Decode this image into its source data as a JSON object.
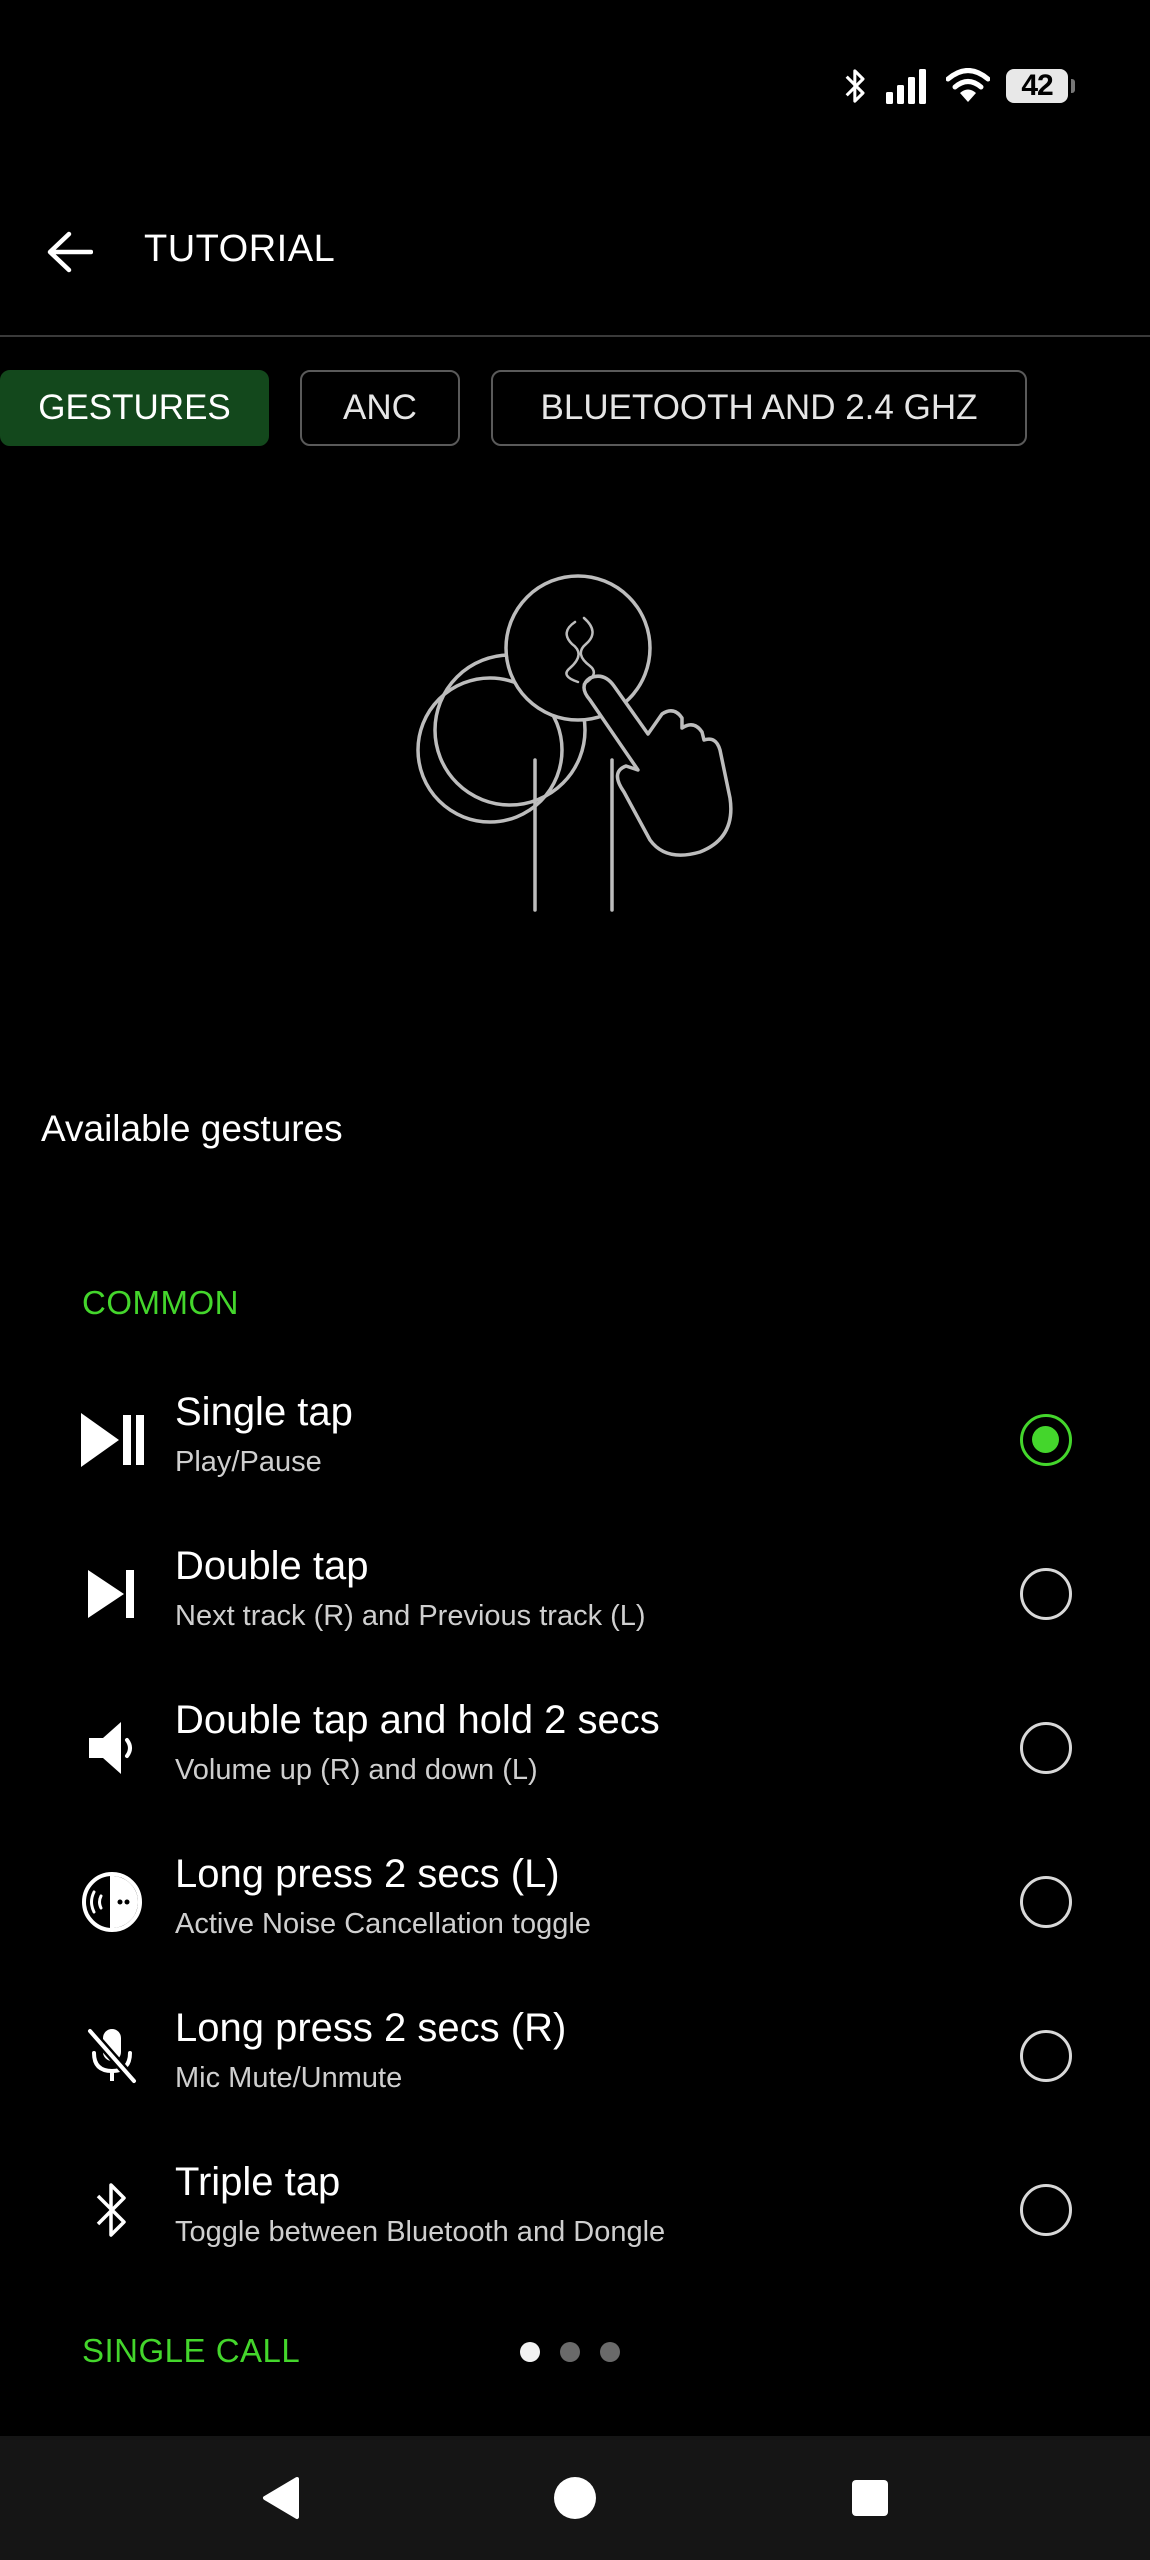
{
  "status_bar": {
    "battery_level": "42",
    "icons": [
      "bluetooth-icon",
      "signal-icon",
      "wifi-icon",
      "battery-icon"
    ]
  },
  "app_bar": {
    "title": "TUTORIAL",
    "back_icon": "arrow-back-icon"
  },
  "tabs": [
    {
      "label": "GESTURES",
      "active": true
    },
    {
      "label": "ANC",
      "active": false
    },
    {
      "label": "BLUETOOTH AND 2.4 GHZ",
      "active": false
    }
  ],
  "illustration": "earbud-touch-gesture-illustration",
  "section_title": "Available gestures",
  "groups": {
    "common": "COMMON",
    "single_call": "SINGLE CALL"
  },
  "gestures": [
    {
      "title": "Single tap",
      "subtitle": "Play/Pause",
      "icon": "play-pause-icon",
      "selected": true
    },
    {
      "title": "Double tap",
      "subtitle": "Next track (R) and Previous track (L)",
      "icon": "skip-next-icon",
      "selected": false
    },
    {
      "title": "Double tap and hold 2 secs",
      "subtitle": "Volume up (R) and down (L)",
      "icon": "volume-icon",
      "selected": false
    },
    {
      "title": "Long press 2 secs (L)",
      "subtitle": "Active Noise Cancellation toggle",
      "icon": "anc-icon",
      "selected": false
    },
    {
      "title": "Long press 2 secs (R)",
      "subtitle": "Mic Mute/Unmute",
      "icon": "mic-off-icon",
      "selected": false
    },
    {
      "title": "Triple tap",
      "subtitle": "Toggle between Bluetooth and Dongle",
      "icon": "bluetooth-icon",
      "selected": false
    }
  ],
  "pager": {
    "count": 3,
    "active_index": 0
  },
  "colors": {
    "accent": "#44d62c",
    "active_tab": "#13481c",
    "background": "#000000"
  },
  "nav_bar": [
    "back-triangle-icon",
    "home-circle-icon",
    "recents-square-icon"
  ]
}
